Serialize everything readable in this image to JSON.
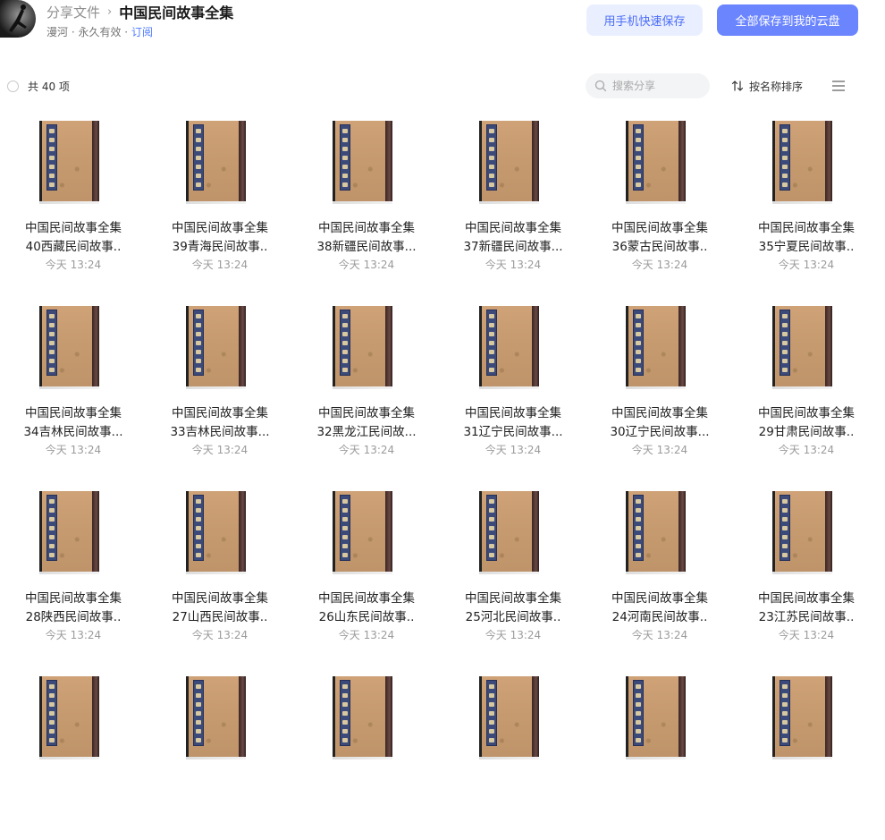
{
  "header": {
    "breadcrumb_parent": "分享文件",
    "breadcrumb_sep": "›",
    "title": "中国民间故事全集",
    "owner": "漫河",
    "dot1": " · ",
    "validity": "永久有效",
    "dot2": " · ",
    "subscribe": "订阅"
  },
  "buttons": {
    "mobile_save": "用手机快速保存",
    "save_all": "全部保存到我的云盘"
  },
  "toolbar": {
    "count": "共 40 项",
    "search_placeholder": "搜索分享",
    "sort_label": "按名称排序"
  },
  "files": [
    {
      "line1": "中国民间故事全集",
      "line2": "40西藏民间故事..",
      "time": "今天 13:24"
    },
    {
      "line1": "中国民间故事全集",
      "line2": "39青海民间故事..",
      "time": "今天 13:24"
    },
    {
      "line1": "中国民间故事全集",
      "line2": "38新疆民间故事...",
      "time": "今天 13:24"
    },
    {
      "line1": "中国民间故事全集",
      "line2": "37新疆民间故事...",
      "time": "今天 13:24"
    },
    {
      "line1": "中国民间故事全集",
      "line2": "36蒙古民间故事..",
      "time": "今天 13:24"
    },
    {
      "line1": "中国民间故事全集",
      "line2": "35宁夏民间故事..",
      "time": "今天 13:24"
    },
    {
      "line1": "中国民间故事全集",
      "line2": "34吉林民间故事...",
      "time": "今天 13:24"
    },
    {
      "line1": "中国民间故事全集",
      "line2": "33吉林民间故事...",
      "time": "今天 13:24"
    },
    {
      "line1": "中国民间故事全集",
      "line2": "32黑龙江民间故...",
      "time": "今天 13:24"
    },
    {
      "line1": "中国民间故事全集",
      "line2": "31辽宁民间故事...",
      "time": "今天 13:24"
    },
    {
      "line1": "中国民间故事全集",
      "line2": "30辽宁民间故事...",
      "time": "今天 13:24"
    },
    {
      "line1": "中国民间故事全集",
      "line2": "29甘肃民间故事..",
      "time": "今天 13:24"
    },
    {
      "line1": "中国民间故事全集",
      "line2": "28陕西民间故事..",
      "time": "今天 13:24"
    },
    {
      "line1": "中国民间故事全集",
      "line2": "27山西民间故事..",
      "time": "今天 13:24"
    },
    {
      "line1": "中国民间故事全集",
      "line2": "26山东民间故事..",
      "time": "今天 13:24"
    },
    {
      "line1": "中国民间故事全集",
      "line2": "25河北民间故事..",
      "time": "今天 13:24"
    },
    {
      "line1": "中国民间故事全集",
      "line2": "24河南民间故事..",
      "time": "今天 13:24"
    },
    {
      "line1": "中国民间故事全集",
      "line2": "23江苏民间故事..",
      "time": "今天 13:24"
    },
    {
      "line1": "",
      "line2": "",
      "time": ""
    },
    {
      "line1": "",
      "line2": "",
      "time": ""
    },
    {
      "line1": "",
      "line2": "",
      "time": ""
    },
    {
      "line1": "",
      "line2": "",
      "time": ""
    },
    {
      "line1": "",
      "line2": "",
      "time": ""
    },
    {
      "line1": "",
      "line2": "",
      "time": ""
    }
  ]
}
